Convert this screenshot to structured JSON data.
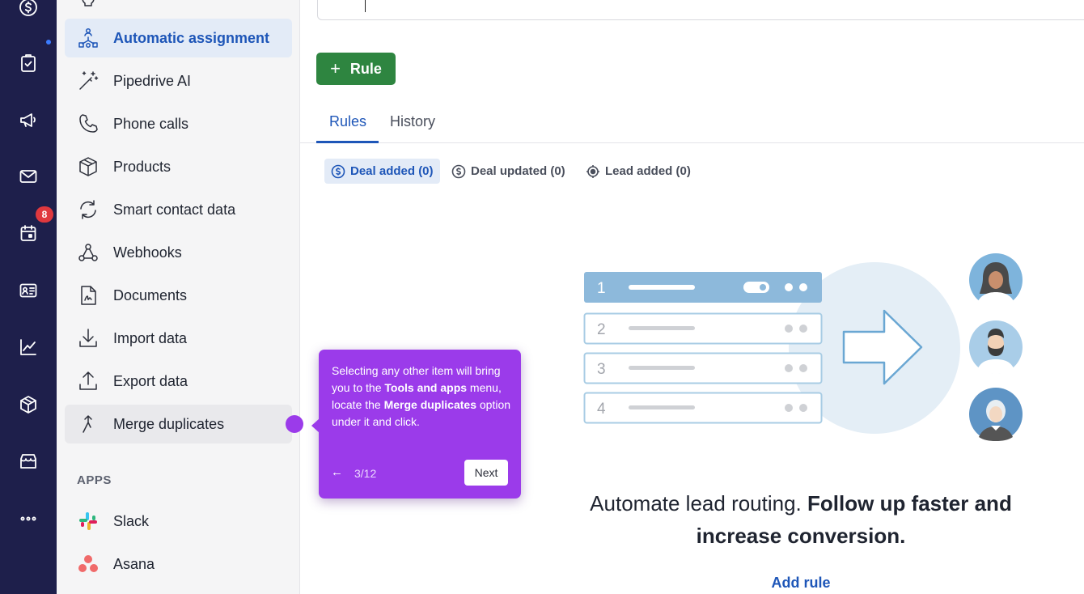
{
  "rail": {
    "items": [
      "dollar-icon",
      "tasks-icon",
      "megaphone-icon",
      "mail-icon",
      "calendar-icon",
      "contacts-icon",
      "insights-icon",
      "products-icon",
      "marketplace-icon",
      "more-icon"
    ],
    "badge": "8"
  },
  "menu": {
    "items": [
      {
        "label": "Automatic assignment",
        "icon": "assignment-icon",
        "state": "active"
      },
      {
        "label": "Pipedrive AI",
        "icon": "magic-wand-icon"
      },
      {
        "label": "Phone calls",
        "icon": "phone-icon"
      },
      {
        "label": "Products",
        "icon": "box-icon"
      },
      {
        "label": "Smart contact data",
        "icon": "refresh-icon"
      },
      {
        "label": "Webhooks",
        "icon": "webhook-icon"
      },
      {
        "label": "Documents",
        "icon": "document-icon"
      },
      {
        "label": "Import data",
        "icon": "download-icon"
      },
      {
        "label": "Export data",
        "icon": "upload-icon"
      },
      {
        "label": "Merge duplicates",
        "icon": "merge-icon",
        "state": "hover"
      }
    ],
    "apps_title": "APPS",
    "apps": [
      {
        "label": "Slack",
        "icon": "slack-icon"
      },
      {
        "label": "Asana",
        "icon": "asana-icon"
      }
    ]
  },
  "main": {
    "rule_button": "Rule",
    "tabs": [
      {
        "label": "Rules",
        "active": true
      },
      {
        "label": "History",
        "active": false
      }
    ],
    "filters": [
      {
        "label": "Deal added (0)",
        "icon": "dollar-icon",
        "active": true
      },
      {
        "label": "Deal updated (0)",
        "icon": "dollar-icon",
        "active": false
      },
      {
        "label": "Lead added (0)",
        "icon": "target-icon",
        "active": false
      }
    ],
    "illustration": {
      "rows": [
        "1",
        "2",
        "3",
        "4"
      ]
    },
    "headline_plain": "Automate lead routing.",
    "headline_bold": "Follow up faster and increase conversion.",
    "add_rule": "Add rule"
  },
  "tooltip": {
    "text_1": "Selecting any other item will bring you to the ",
    "bold_1": "Tools and apps",
    "text_2": " menu, locate the ",
    "bold_2": "Merge duplicates",
    "text_3": " option under it and click.",
    "back": "←",
    "step": "3/12",
    "next": "Next"
  },
  "colors": {
    "rail_bg": "#1e1f4b",
    "accent_blue": "#1e56b8",
    "primary_green": "#2e8540",
    "tooltip_purple": "#9b3bea",
    "notification_red": "#e0383e"
  }
}
